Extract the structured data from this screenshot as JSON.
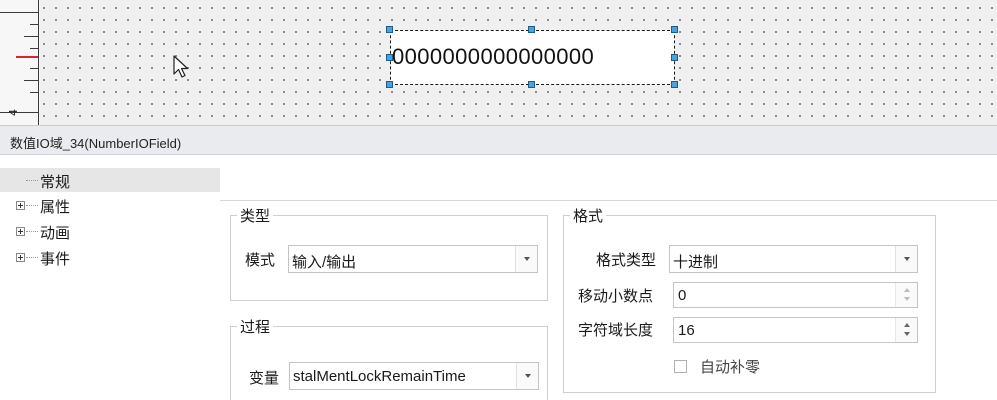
{
  "canvas": {
    "ruler_number": "4",
    "field_text": "0000000000000000"
  },
  "title_bar": {
    "text": "数值IO域_34(NumberIOField)"
  },
  "tree": {
    "items": [
      {
        "label": "常规",
        "expandable": false,
        "selected": true
      },
      {
        "label": "属性",
        "expandable": true,
        "selected": false
      },
      {
        "label": "动画",
        "expandable": true,
        "selected": false
      },
      {
        "label": "事件",
        "expandable": true,
        "selected": false
      }
    ]
  },
  "type_group": {
    "legend": "类型",
    "mode_label": "模式",
    "mode_value": "输入/输出"
  },
  "process_group": {
    "legend": "过程",
    "variable_label": "变量",
    "variable_value": "stalMentLockRemainTime"
  },
  "format_group": {
    "legend": "格式",
    "format_type_label": "格式类型",
    "format_type_value": "十进制",
    "shift_decimal_label": "移动小数点",
    "shift_decimal_value": "0",
    "field_length_label": "字符域长度",
    "field_length_value": "16",
    "auto_zero_label": "自动补零",
    "auto_zero_checked": false
  },
  "colors": {
    "handle": "#4aa3df",
    "ruler_marker": "#d9262a",
    "title_bar_bg": "#e9ebef",
    "selected_tree_bg": "#e6e6e6"
  }
}
